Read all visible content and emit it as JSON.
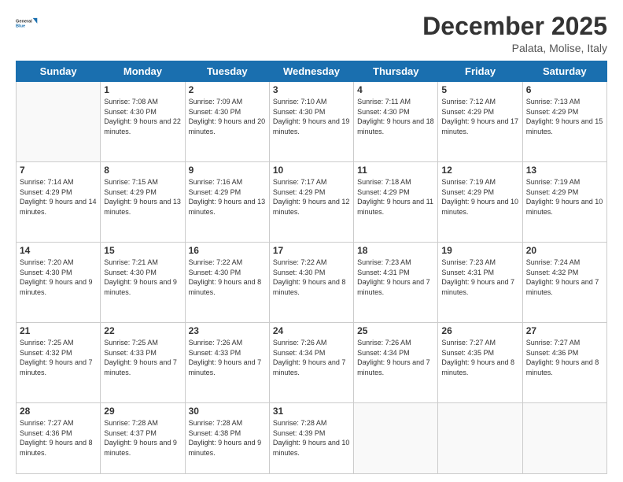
{
  "logo": {
    "text_general": "General",
    "text_blue": "Blue"
  },
  "header": {
    "month": "December 2025",
    "location": "Palata, Molise, Italy"
  },
  "days_of_week": [
    "Sunday",
    "Monday",
    "Tuesday",
    "Wednesday",
    "Thursday",
    "Friday",
    "Saturday"
  ],
  "weeks": [
    [
      {
        "day": "",
        "sunrise": "",
        "sunset": "",
        "daylight": ""
      },
      {
        "day": "1",
        "sunrise": "Sunrise: 7:08 AM",
        "sunset": "Sunset: 4:30 PM",
        "daylight": "Daylight: 9 hours and 22 minutes."
      },
      {
        "day": "2",
        "sunrise": "Sunrise: 7:09 AM",
        "sunset": "Sunset: 4:30 PM",
        "daylight": "Daylight: 9 hours and 20 minutes."
      },
      {
        "day": "3",
        "sunrise": "Sunrise: 7:10 AM",
        "sunset": "Sunset: 4:30 PM",
        "daylight": "Daylight: 9 hours and 19 minutes."
      },
      {
        "day": "4",
        "sunrise": "Sunrise: 7:11 AM",
        "sunset": "Sunset: 4:30 PM",
        "daylight": "Daylight: 9 hours and 18 minutes."
      },
      {
        "day": "5",
        "sunrise": "Sunrise: 7:12 AM",
        "sunset": "Sunset: 4:29 PM",
        "daylight": "Daylight: 9 hours and 17 minutes."
      },
      {
        "day": "6",
        "sunrise": "Sunrise: 7:13 AM",
        "sunset": "Sunset: 4:29 PM",
        "daylight": "Daylight: 9 hours and 15 minutes."
      }
    ],
    [
      {
        "day": "7",
        "sunrise": "Sunrise: 7:14 AM",
        "sunset": "Sunset: 4:29 PM",
        "daylight": "Daylight: 9 hours and 14 minutes."
      },
      {
        "day": "8",
        "sunrise": "Sunrise: 7:15 AM",
        "sunset": "Sunset: 4:29 PM",
        "daylight": "Daylight: 9 hours and 13 minutes."
      },
      {
        "day": "9",
        "sunrise": "Sunrise: 7:16 AM",
        "sunset": "Sunset: 4:29 PM",
        "daylight": "Daylight: 9 hours and 13 minutes."
      },
      {
        "day": "10",
        "sunrise": "Sunrise: 7:17 AM",
        "sunset": "Sunset: 4:29 PM",
        "daylight": "Daylight: 9 hours and 12 minutes."
      },
      {
        "day": "11",
        "sunrise": "Sunrise: 7:18 AM",
        "sunset": "Sunset: 4:29 PM",
        "daylight": "Daylight: 9 hours and 11 minutes."
      },
      {
        "day": "12",
        "sunrise": "Sunrise: 7:19 AM",
        "sunset": "Sunset: 4:29 PM",
        "daylight": "Daylight: 9 hours and 10 minutes."
      },
      {
        "day": "13",
        "sunrise": "Sunrise: 7:19 AM",
        "sunset": "Sunset: 4:29 PM",
        "daylight": "Daylight: 9 hours and 10 minutes."
      }
    ],
    [
      {
        "day": "14",
        "sunrise": "Sunrise: 7:20 AM",
        "sunset": "Sunset: 4:30 PM",
        "daylight": "Daylight: 9 hours and 9 minutes."
      },
      {
        "day": "15",
        "sunrise": "Sunrise: 7:21 AM",
        "sunset": "Sunset: 4:30 PM",
        "daylight": "Daylight: 9 hours and 9 minutes."
      },
      {
        "day": "16",
        "sunrise": "Sunrise: 7:22 AM",
        "sunset": "Sunset: 4:30 PM",
        "daylight": "Daylight: 9 hours and 8 minutes."
      },
      {
        "day": "17",
        "sunrise": "Sunrise: 7:22 AM",
        "sunset": "Sunset: 4:30 PM",
        "daylight": "Daylight: 9 hours and 8 minutes."
      },
      {
        "day": "18",
        "sunrise": "Sunrise: 7:23 AM",
        "sunset": "Sunset: 4:31 PM",
        "daylight": "Daylight: 9 hours and 7 minutes."
      },
      {
        "day": "19",
        "sunrise": "Sunrise: 7:23 AM",
        "sunset": "Sunset: 4:31 PM",
        "daylight": "Daylight: 9 hours and 7 minutes."
      },
      {
        "day": "20",
        "sunrise": "Sunrise: 7:24 AM",
        "sunset": "Sunset: 4:32 PM",
        "daylight": "Daylight: 9 hours and 7 minutes."
      }
    ],
    [
      {
        "day": "21",
        "sunrise": "Sunrise: 7:25 AM",
        "sunset": "Sunset: 4:32 PM",
        "daylight": "Daylight: 9 hours and 7 minutes."
      },
      {
        "day": "22",
        "sunrise": "Sunrise: 7:25 AM",
        "sunset": "Sunset: 4:33 PM",
        "daylight": "Daylight: 9 hours and 7 minutes."
      },
      {
        "day": "23",
        "sunrise": "Sunrise: 7:26 AM",
        "sunset": "Sunset: 4:33 PM",
        "daylight": "Daylight: 9 hours and 7 minutes."
      },
      {
        "day": "24",
        "sunrise": "Sunrise: 7:26 AM",
        "sunset": "Sunset: 4:34 PM",
        "daylight": "Daylight: 9 hours and 7 minutes."
      },
      {
        "day": "25",
        "sunrise": "Sunrise: 7:26 AM",
        "sunset": "Sunset: 4:34 PM",
        "daylight": "Daylight: 9 hours and 7 minutes."
      },
      {
        "day": "26",
        "sunrise": "Sunrise: 7:27 AM",
        "sunset": "Sunset: 4:35 PM",
        "daylight": "Daylight: 9 hours and 8 minutes."
      },
      {
        "day": "27",
        "sunrise": "Sunrise: 7:27 AM",
        "sunset": "Sunset: 4:36 PM",
        "daylight": "Daylight: 9 hours and 8 minutes."
      }
    ],
    [
      {
        "day": "28",
        "sunrise": "Sunrise: 7:27 AM",
        "sunset": "Sunset: 4:36 PM",
        "daylight": "Daylight: 9 hours and 8 minutes."
      },
      {
        "day": "29",
        "sunrise": "Sunrise: 7:28 AM",
        "sunset": "Sunset: 4:37 PM",
        "daylight": "Daylight: 9 hours and 9 minutes."
      },
      {
        "day": "30",
        "sunrise": "Sunrise: 7:28 AM",
        "sunset": "Sunset: 4:38 PM",
        "daylight": "Daylight: 9 hours and 9 minutes."
      },
      {
        "day": "31",
        "sunrise": "Sunrise: 7:28 AM",
        "sunset": "Sunset: 4:39 PM",
        "daylight": "Daylight: 9 hours and 10 minutes."
      },
      {
        "day": "",
        "sunrise": "",
        "sunset": "",
        "daylight": ""
      },
      {
        "day": "",
        "sunrise": "",
        "sunset": "",
        "daylight": ""
      },
      {
        "day": "",
        "sunrise": "",
        "sunset": "",
        "daylight": ""
      }
    ]
  ]
}
